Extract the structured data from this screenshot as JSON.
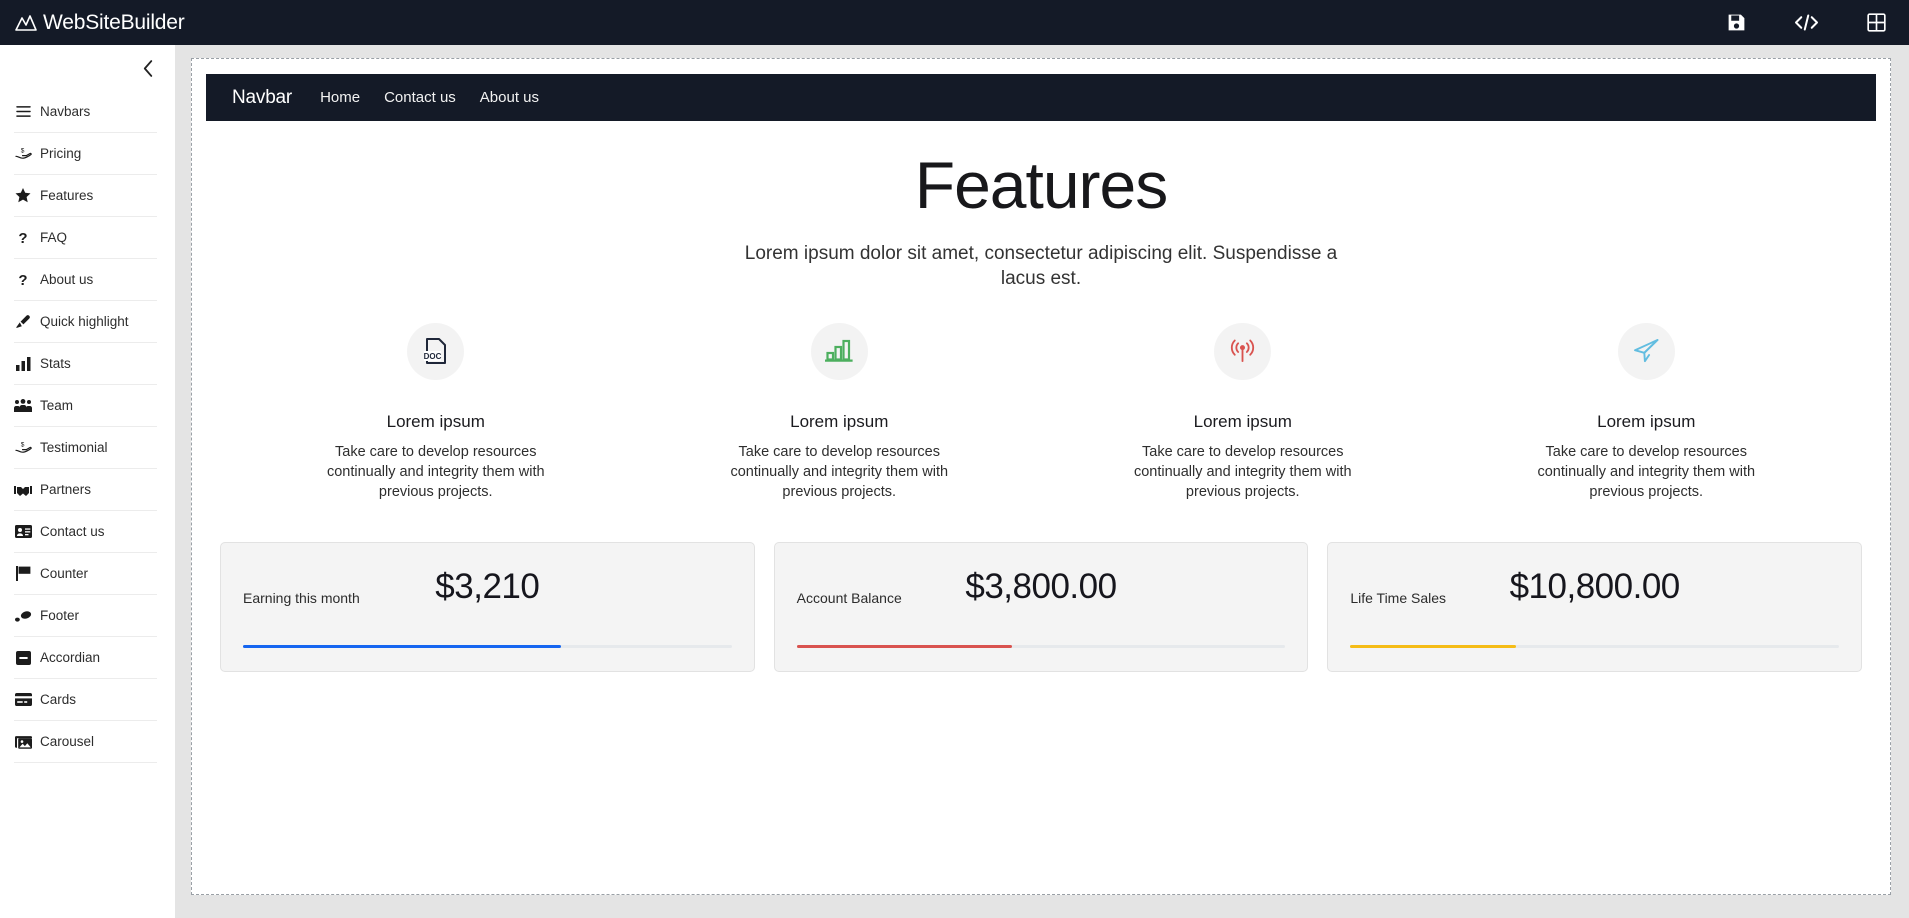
{
  "app": {
    "name": "WebSiteBuilder",
    "logo_icon": "mountain-logo-icon"
  },
  "topbar": {
    "actions": [
      {
        "name": "save-icon",
        "label": "Save"
      },
      {
        "name": "code-icon",
        "label": "View code"
      },
      {
        "name": "grid-icon",
        "label": "Layouts"
      }
    ]
  },
  "sidebar": {
    "collapse_icon": "chevron-left-icon",
    "items": [
      {
        "label": "Navbars",
        "icon": "hamburger-icon"
      },
      {
        "label": "Pricing",
        "icon": "hand-holding-dollar-icon"
      },
      {
        "label": "Features",
        "icon": "star-icon"
      },
      {
        "label": "FAQ",
        "icon": "question-mark-icon"
      },
      {
        "label": "About us",
        "icon": "question-mark-icon"
      },
      {
        "label": "Quick highlight",
        "icon": "highlighter-pen-icon"
      },
      {
        "label": "Stats",
        "icon": "bar-chart-icon"
      },
      {
        "label": "Team",
        "icon": "people-group-icon"
      },
      {
        "label": "Testimonial",
        "icon": "hand-holding-dollar-icon"
      },
      {
        "label": "Partners",
        "icon": "handshake-icon"
      },
      {
        "label": "Contact us",
        "icon": "contact-card-icon"
      },
      {
        "label": "Counter",
        "icon": "flag-icon"
      },
      {
        "label": "Footer",
        "icon": "footprints-icon"
      },
      {
        "label": "Accordian",
        "icon": "minus-square-icon"
      },
      {
        "label": "Cards",
        "icon": "credit-card-icon"
      },
      {
        "label": "Carousel",
        "icon": "images-icon"
      }
    ]
  },
  "preview": {
    "navbar": {
      "brand": "Navbar",
      "links": [
        "Home",
        "Contact us",
        "About us"
      ]
    },
    "features": {
      "title": "Features",
      "subtitle": "Lorem ipsum dolor sit amet, consectetur adipiscing elit. Suspendisse a lacus est.",
      "items": [
        {
          "icon": "doc-file-icon",
          "icon_color": "#1f2739",
          "heading": "Lorem ipsum",
          "text": "Take care to develop resources continually and integrity them with previous projects."
        },
        {
          "icon": "bar-chart-icon",
          "icon_color": "#4caf5e",
          "heading": "Lorem ipsum",
          "text": "Take care to develop resources continually and integrity them with previous projects."
        },
        {
          "icon": "broadcast-tower-icon",
          "icon_color": "#d9534f",
          "heading": "Lorem ipsum",
          "text": "Take care to develop resources continually and integrity them with previous projects."
        },
        {
          "icon": "paper-plane-send-icon",
          "icon_color": "#62bde0",
          "heading": "Lorem ipsum",
          "text": "Take care to develop resources continually and integrity them with previous projects."
        }
      ]
    },
    "stats": [
      {
        "value": "$3,210",
        "label": "Earning this month",
        "progress": 65,
        "color": "#1565f0"
      },
      {
        "value": "$3,800.00",
        "label": "Account Balance",
        "progress": 44,
        "color": "#d9534f"
      },
      {
        "value": "$10,800.00",
        "label": "Life Time Sales",
        "progress": 34,
        "color": "#f5bc16"
      }
    ]
  },
  "colors": {
    "dark": "#141a27",
    "canvas_bg": "#e4e4e4",
    "card_bg": "#f4f4f4"
  }
}
